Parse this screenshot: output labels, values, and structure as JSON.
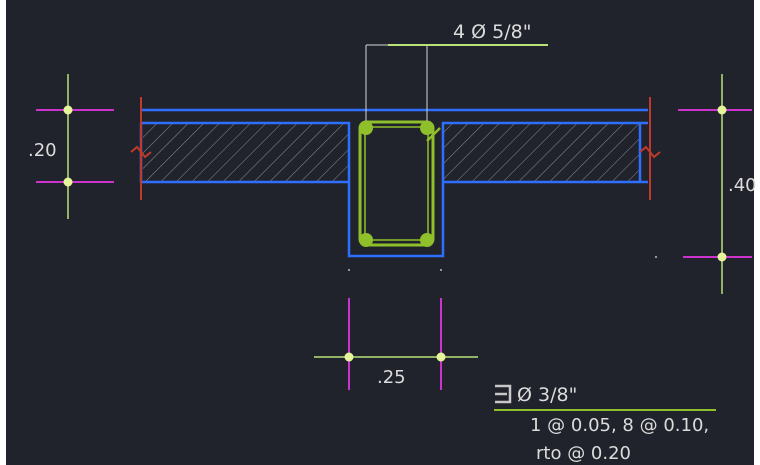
{
  "drawing": {
    "top_bar_label": "4 Ø  5/8\"",
    "slab_thickness": ".20",
    "total_height": ".40",
    "web_width": ".25",
    "stirrup": {
      "diameter": "Ø 3/8\"",
      "spacing_line1": "1 @ 0.05, 8 @ 0.10,",
      "spacing_line2": "rto @ 0.20"
    }
  },
  "colors": {
    "background": "#20232b",
    "outline": "#2f6fff",
    "rebar": "#8fbf2a",
    "text": "#dcdcdc",
    "dim_line": "#b9e27a",
    "dim_ext": "#cc33cc",
    "break_mark": "#c0392b",
    "hatch": "#8a8d94"
  }
}
